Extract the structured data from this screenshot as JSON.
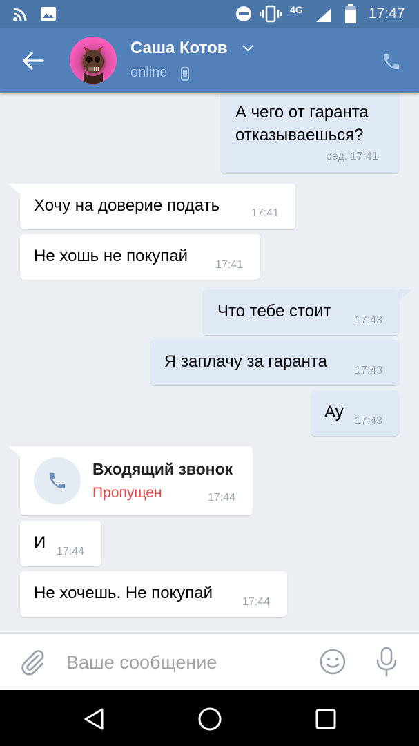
{
  "status_bar": {
    "network": "4G",
    "time": "17:47"
  },
  "header": {
    "contact_name": "Саша Котов",
    "status": "online"
  },
  "messages": [
    {
      "direction": "out",
      "lines": [
        "А чего от гаранта",
        "отказываешься?"
      ],
      "time": "ред. 17:41"
    },
    {
      "direction": "in",
      "text": "Хочу на доверие подать",
      "time": "17:41"
    },
    {
      "direction": "in",
      "text": "Не хошь не покупай",
      "time": "17:41"
    },
    {
      "direction": "out",
      "text": "Что тебе стоит",
      "time": "17:43"
    },
    {
      "direction": "out",
      "text": "Я заплачу за гаранта",
      "time": "17:43"
    },
    {
      "direction": "out",
      "text": "Ау",
      "time": "17:43"
    },
    {
      "direction": "in",
      "type": "call",
      "title": "Входящий звонок",
      "status": "Пропущен",
      "time": "17:44"
    },
    {
      "direction": "in",
      "text": "И",
      "time": "17:44"
    },
    {
      "direction": "in",
      "text": "Не хочешь. Не покупай",
      "time": "17:44"
    }
  ],
  "input": {
    "placeholder": "Ваше сообщение"
  },
  "colors": {
    "status_bar": "#4a76a8",
    "header": "#5181b8",
    "incoming_bubble": "#ffffff",
    "outgoing_bubble": "#dfe9f5",
    "missed_call": "#e64646",
    "background": "#ebeff3"
  }
}
